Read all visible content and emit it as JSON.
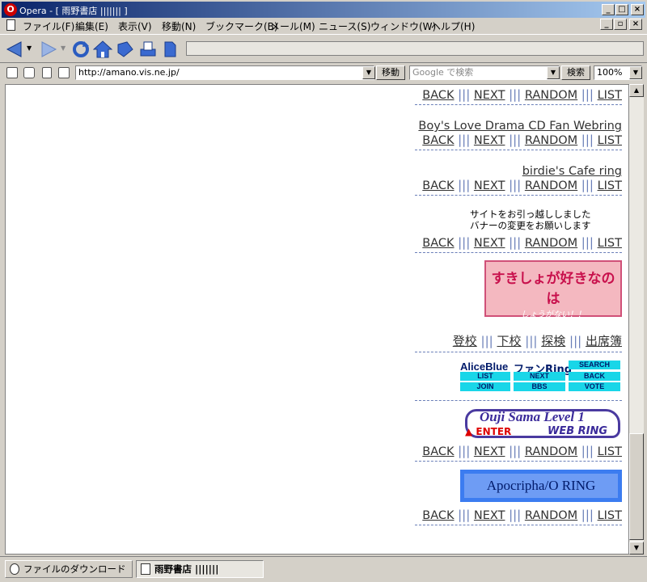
{
  "window": {
    "title": "Opera - [ 雨野書店 ||||||| ]",
    "app_icon": "opera-icon",
    "minimize": "_",
    "maximize": "□",
    "close": "×"
  },
  "menu": [
    "ファイル(F)",
    "編集(E)",
    "表示(V)",
    "移動(N)",
    "ブックマーク(B)",
    "メール(M)",
    "ニュース(S)",
    "ウィンドウ(W)",
    "ヘルプ(H)"
  ],
  "toolbar": {
    "icons": [
      "back-arrow-icon",
      "forward-arrow-icon",
      "reload-icon",
      "home-icon",
      "hotlist-icon",
      "print-icon",
      "new-page-icon"
    ]
  },
  "address_bar": {
    "url": "http://amano.vis.ne.jp/",
    "go_label": "移動",
    "search_placeholder": "Google で検索",
    "search_label": "検索",
    "zoom": "100%"
  },
  "content": {
    "nav": {
      "back": "BACK",
      "next": "NEXT",
      "random": "RANDOM",
      "list": "LIST",
      "sep": "|||"
    },
    "rings": [
      {
        "title": "Boy's Love Drama CD Fan Webring"
      },
      {
        "title": "birdie's Cafe ring"
      }
    ],
    "notice": [
      "サイトをお引っ越ししました",
      "バナーの変更をお願いします"
    ],
    "banner_sukishou": {
      "line1": "すきしょが好きなのは",
      "line2": "しょうがない！！",
      "line3": "WEB RING"
    },
    "sukishou_links": [
      "登校",
      "下校",
      "探検",
      "出席簿"
    ],
    "banner_alice": {
      "title": "AliceBlue",
      "subtitle": "ファンRing",
      "buttons": [
        "SEARCH",
        "LIST",
        "NEXT",
        "BACK",
        "JOIN",
        "BBS",
        "VOTE"
      ]
    },
    "banner_ouji": {
      "line1": "Ouji Sama  Level 1",
      "enter": "▲ ENTER",
      "webring": "WEB RING"
    },
    "banner_apocripha": {
      "text": "Apocripha/O RING"
    }
  },
  "status_bar": {
    "tabs": [
      {
        "label": "ファイルのダウンロード",
        "active": false
      },
      {
        "label": "雨野書店 |||||||",
        "active": true
      }
    ]
  }
}
